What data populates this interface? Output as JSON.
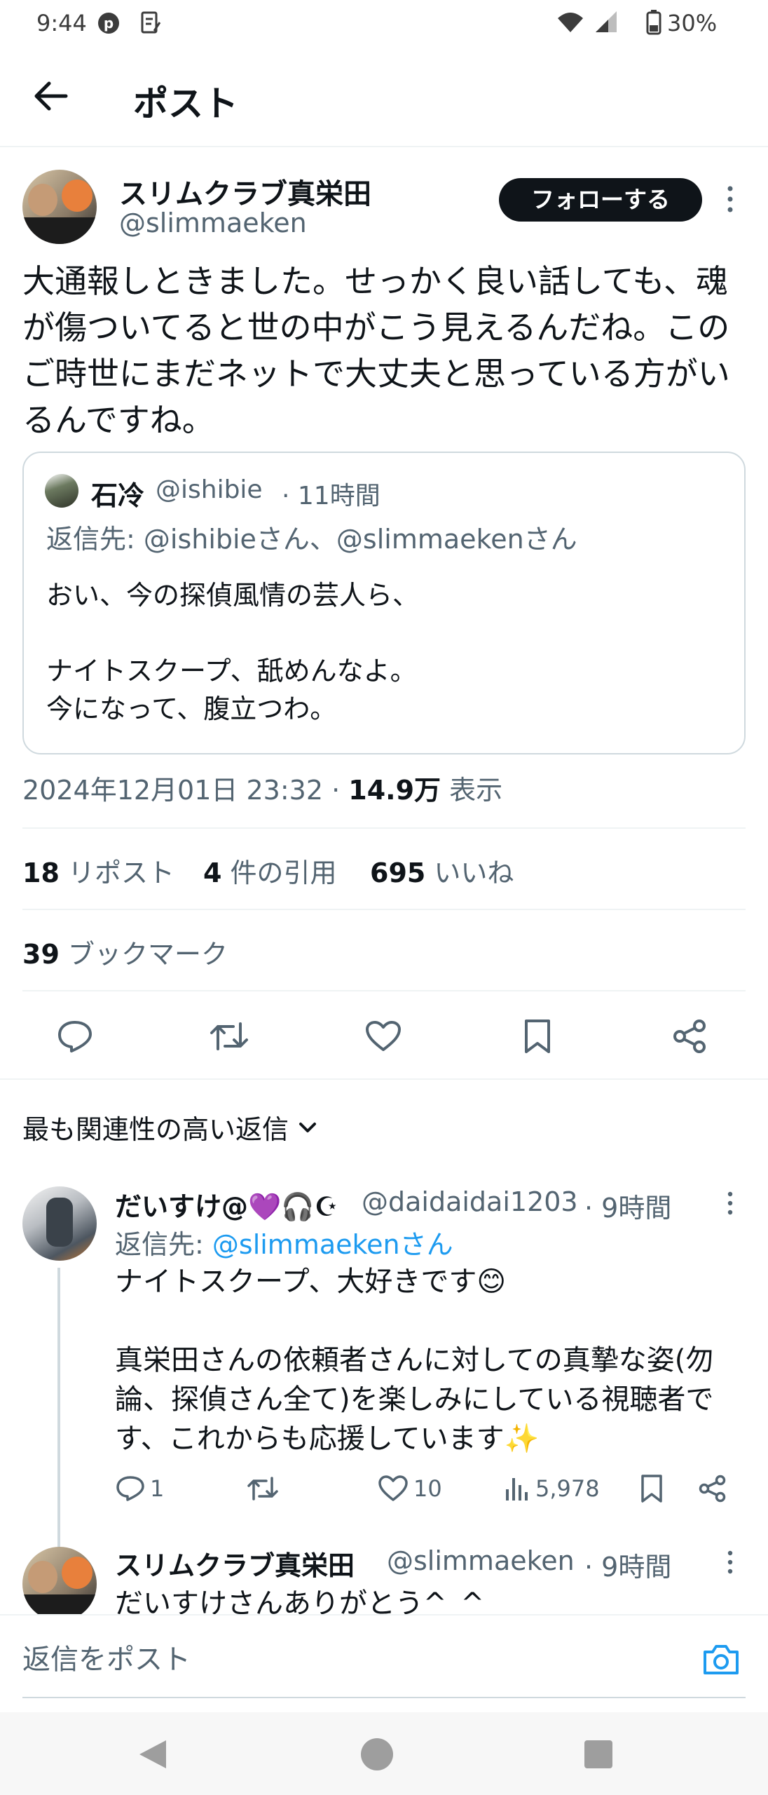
{
  "status_bar": {
    "time": "9:44",
    "battery": "30%"
  },
  "header": {
    "title": "ポスト"
  },
  "post": {
    "author_name": "スリムクラブ真栄田",
    "author_handle": "@slimmaeken",
    "follow_label": "フォローする",
    "text": "大通報しときました。せっかく良い話しても、魂が傷ついてると世の中がこう見えるんだね。このご時世にまだネットで大丈夫と思っている方がいるんですね。",
    "quote": {
      "name": "石冷",
      "handle": "@ishibie",
      "time": "· 11時間",
      "reply_to": "返信先: @ishibieさん、@slimmaekenさん",
      "text": "おい、今の探偵風情の芸人ら、\n\nナイトスクープ、舐めんなよ。\n今になって、腹立つわ。"
    },
    "timestamp": "2024年12月01日 23:32 · ",
    "views_count": "14.9万",
    "views_label": " 表示",
    "stats": {
      "reposts_count": "18",
      "reposts_label": "リポスト",
      "quotes_count": "4",
      "quotes_label": "件の引用",
      "likes_count": "695",
      "likes_label": "いいね",
      "bookmarks_count": "39",
      "bookmarks_label": "ブックマーク"
    }
  },
  "sort": {
    "label": "最も関連性の高い返信"
  },
  "replies": [
    {
      "name": "だいすけ@💜🎧☪",
      "handle": "@daidaidai1203",
      "time": "· 9時間",
      "reply_prefix": "返信先: ",
      "reply_to": "@slimmaekenさん",
      "text": "ナイトスクープ、大好きです😊\n\n真栄田さんの依頼者さんに対しての真摯な姿(勿論、探偵さん全て)を楽しみにしている視聴者です、これからも応援しています✨",
      "reply_count": "1",
      "like_count": "10",
      "view_count": "5,978"
    },
    {
      "name": "スリムクラブ真栄田",
      "handle": "@slimmaeken",
      "time": "· 9時間",
      "text": "だいすけさんありがとう^_^"
    }
  ],
  "composer": {
    "placeholder": "返信をポスト"
  },
  "colors": {
    "link": "#1d9bf0",
    "text": "#0f1419",
    "muted": "#536471"
  }
}
